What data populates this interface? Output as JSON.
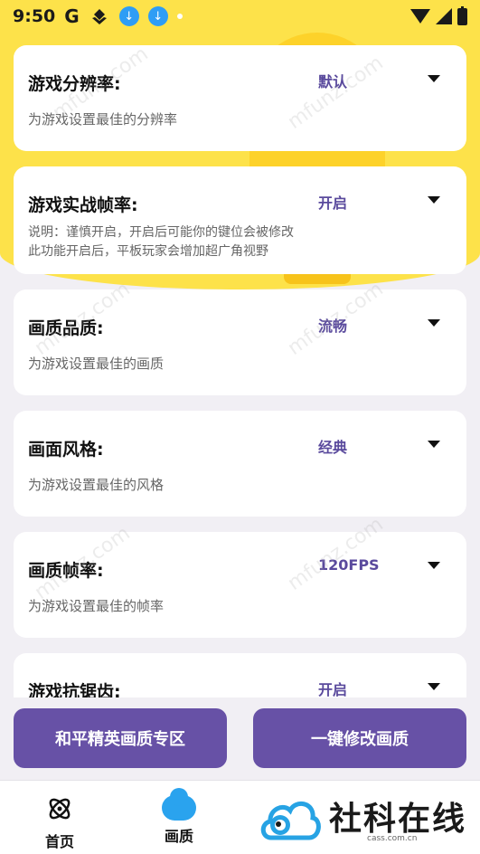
{
  "status_bar": {
    "time": "9:50",
    "g_label": "G",
    "icons": [
      "google-icon",
      "maps-icon",
      "download-icon",
      "download-icon",
      "dot-icon",
      "wifi-icon",
      "signal-icon",
      "battery-icon"
    ]
  },
  "settings": [
    {
      "title": "游戏分辨率:",
      "value": "默认",
      "desc": [
        "为游戏设置最佳的分辨率"
      ]
    },
    {
      "title": "游戏实战帧率:",
      "value": "开启",
      "desc": [
        "说明：谨慎开启，开启后可能你的键位会被修改",
        "此功能开启后，平板玩家会增加超广角视野"
      ]
    },
    {
      "title": "画质品质:",
      "value": "流畅",
      "desc": [
        "为游戏设置最佳的画质"
      ]
    },
    {
      "title": "画面风格:",
      "value": "经典",
      "desc": [
        "为游戏设置最佳的风格"
      ]
    },
    {
      "title": "画质帧率:",
      "value": "120FPS",
      "desc": [
        "为游戏设置最佳的帧率"
      ]
    },
    {
      "title": "游戏抗锯齿:",
      "value": "开启",
      "desc": []
    }
  ],
  "buttons": {
    "left": "和平精英画质专区",
    "right": "一键修改画质"
  },
  "nav": {
    "home": "首页",
    "quality": "画质"
  },
  "logo": {
    "text": "社科在线",
    "sub": "cass.com.cn"
  },
  "watermark": "mfunz.com",
  "colors": {
    "accent": "#6751a6",
    "value_text": "#5a4a9d",
    "header_yellow": "#fde24a",
    "nav_blue": "#2aa3ee"
  }
}
